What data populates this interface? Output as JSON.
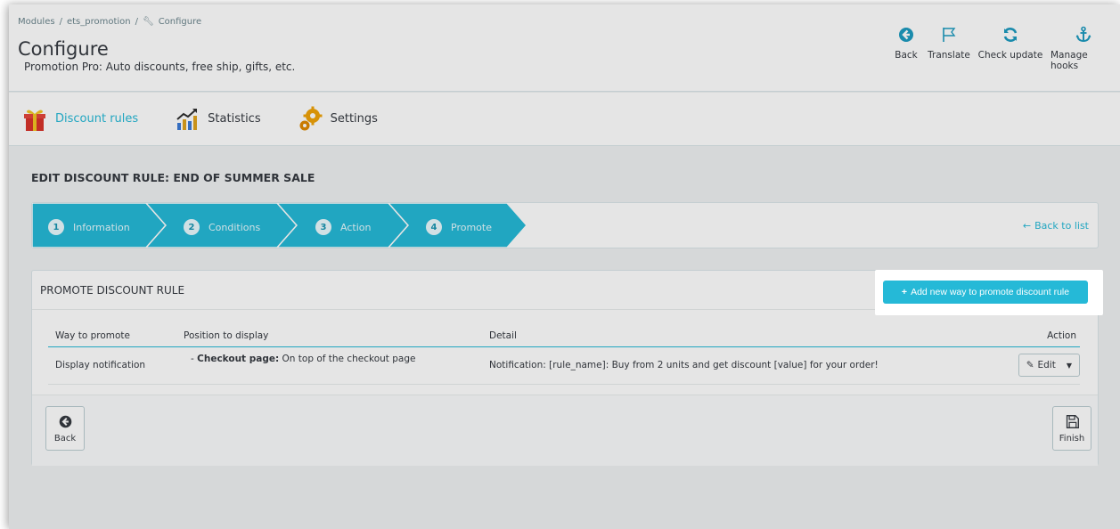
{
  "breadcrumb": [
    "Modules",
    "ets_promotion",
    "Configure"
  ],
  "header": {
    "title": "Configure",
    "subtitle": "Promotion Pro: Auto discounts, free ship, gifts, etc."
  },
  "toolbar": {
    "back": "Back",
    "translate": "Translate",
    "check_update": "Check update",
    "manage_hooks": "Manage hooks"
  },
  "tabs": [
    {
      "label": "Discount rules",
      "icon": "gift-icon"
    },
    {
      "label": "Statistics",
      "icon": "chart-icon"
    },
    {
      "label": "Settings",
      "icon": "gear-icon"
    }
  ],
  "section_title": "EDIT DISCOUNT RULE: END OF SUMMER SALE",
  "steps": [
    {
      "num": "1",
      "label": "Information"
    },
    {
      "num": "2",
      "label": "Conditions"
    },
    {
      "num": "3",
      "label": "Action"
    },
    {
      "num": "4",
      "label": "Promote"
    }
  ],
  "back_to_list": "Back to list",
  "card": {
    "title": "PROMOTE DISCOUNT RULE",
    "add_button": "Add new way to promote discount rule",
    "columns": [
      "Way to promote",
      "Position to display",
      "Detail",
      "Action"
    ],
    "rows": [
      {
        "way": "Display notification",
        "position_dash": "-",
        "position_label": "Checkout page:",
        "position_value": "On top of the checkout page",
        "detail": "Notification: [rule_name]: Buy from 2 units and get discount [value] for your order!",
        "action": "Edit"
      }
    ],
    "back_button": "Back",
    "finish_button": "Finish"
  },
  "colors": {
    "accent": "#25b9d7",
    "step_fill": "#25b9d7"
  }
}
